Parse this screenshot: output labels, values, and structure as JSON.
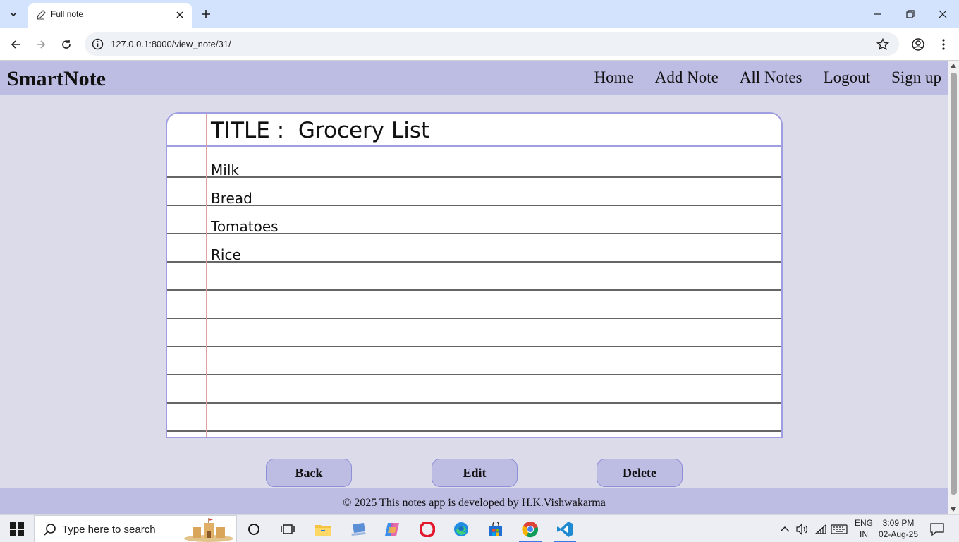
{
  "browser": {
    "tab_title": "Full note",
    "url": "127.0.0.1:8000/view_note/31/"
  },
  "navbar": {
    "brand": "SmartNote",
    "links": [
      "Home",
      "Add Note",
      "All Notes",
      "Logout",
      "Sign up"
    ]
  },
  "note": {
    "title_label": "TITLE :",
    "title": "Grocery List",
    "lines": [
      "Milk",
      "Bread",
      "Tomatoes",
      "Rice"
    ]
  },
  "actions": {
    "back": "Back",
    "edit": "Edit",
    "delete": "Delete"
  },
  "footer": {
    "text": "© 2025 This notes app is developed by H.K.Vishwakarma"
  },
  "taskbar": {
    "search_placeholder": "Type here to search",
    "lang_top": "ENG",
    "lang_bottom": "IN",
    "time": "3:09 PM",
    "date": "02-Aug-25"
  },
  "colors": {
    "navbar_bg": "#bdbce3",
    "page_bg": "#dcdbea",
    "paper_border": "#9f9ee0",
    "margin_line": "#d9a3a3"
  }
}
